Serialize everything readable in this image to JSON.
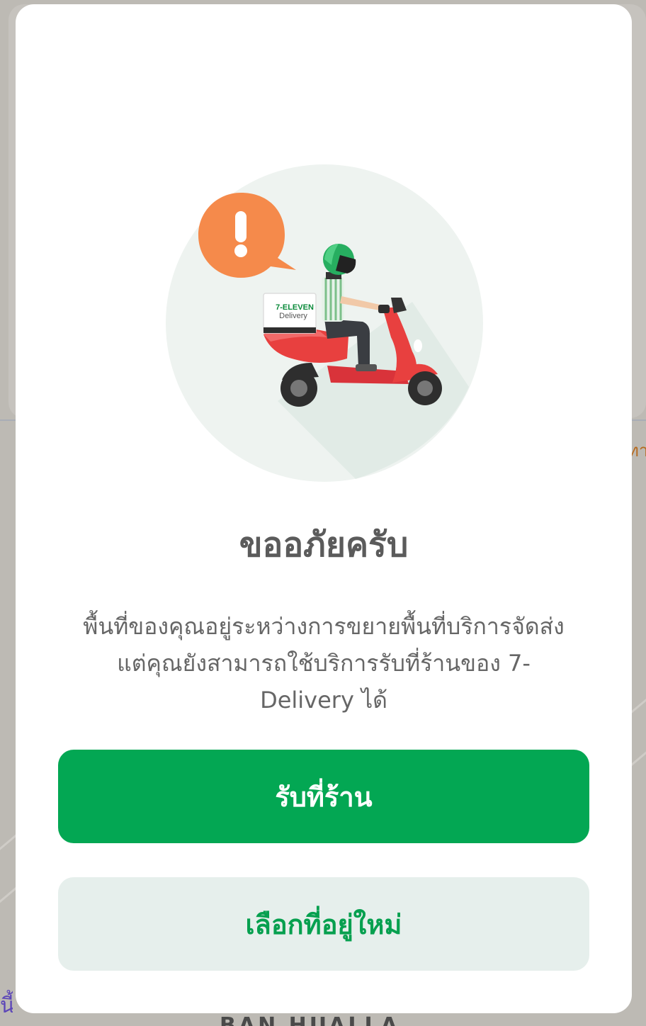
{
  "background": {
    "label_right": "ทาน",
    "label_left": "นี้",
    "label_bottom": "BAN HUALLA"
  },
  "modal": {
    "illustration": {
      "icon": "delivery-scooter-warning",
      "box_brand": "7-ELEVEN",
      "box_label": "Delivery"
    },
    "title": "ขออภัยครับ",
    "description_line1": "พื้นที่ของคุณอยู่ระหว่างการขยายพื้นที่บริการจัดส่ง",
    "description_line2": "แต่คุณยังสามารถใช้บริการรับที่ร้านของ 7-",
    "description_line3": "Delivery ได้",
    "primary_button": "รับที่ร้าน",
    "secondary_button": "เลือกที่อยู่ใหม่"
  },
  "colors": {
    "primary_green": "#03a753",
    "secondary_bg": "#e6efec",
    "warning_orange": "#f58a4b",
    "scooter_red": "#e8403f"
  }
}
